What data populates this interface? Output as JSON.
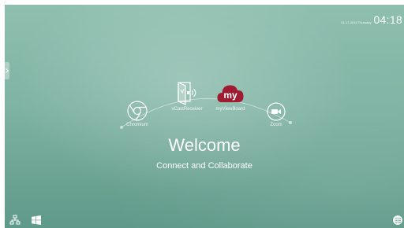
{
  "status_bar": {
    "date": "01-17-2019 Thursday",
    "time": "04:18"
  },
  "apps": [
    {
      "label": "Chromium",
      "icon": "chromium-icon"
    },
    {
      "label": "vCastReceiver",
      "icon": "vcast-receiver-icon"
    },
    {
      "label": "myViewBoard",
      "icon": "myviewboard-icon",
      "logo_text": "my"
    },
    {
      "label": "Zoom",
      "icon": "zoom-icon"
    }
  ],
  "welcome": {
    "title": "Welcome",
    "subtitle": "Connect and Collaborate"
  },
  "taskbar": {
    "icons": [
      "network-icon",
      "windows-icon",
      "apps-grid-icon"
    ]
  },
  "colors": {
    "background": "#7fb3a3",
    "myviewboard_red": "#9e1b32",
    "text": "#ffffff"
  }
}
